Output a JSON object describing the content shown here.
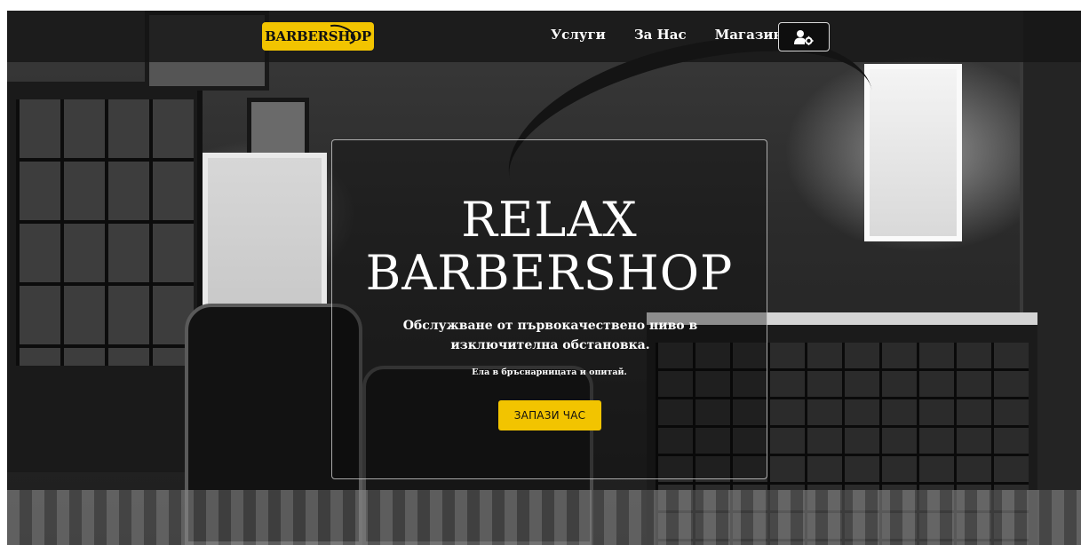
{
  "brand": {
    "logo_text": "BARBERSHOP",
    "accent_color": "#f2c400"
  },
  "nav": {
    "links": [
      {
        "label": "Услуги"
      },
      {
        "label": "За Нас"
      },
      {
        "label": "Магазин"
      }
    ],
    "account_icon": "user-gear-icon"
  },
  "hero": {
    "title_line1": "RELAX",
    "title_line2": "BARBERSHOP",
    "subtitle": "Обслужване от първокачествено ниво в изключителна обстановка.",
    "note": "Ела в бръснарницата и опитай.",
    "button_label": "ЗАПАЗИ ЧАС"
  }
}
